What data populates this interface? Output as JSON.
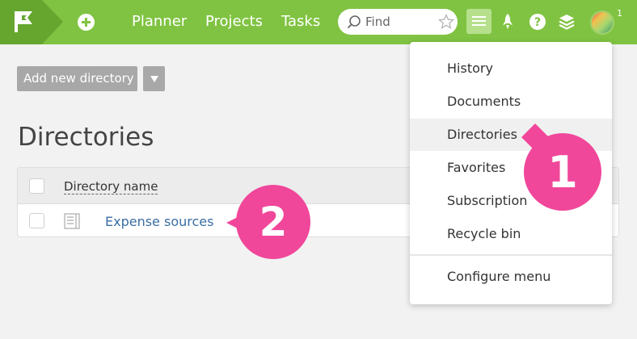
{
  "nav": {
    "links": [
      "Planner",
      "Projects",
      "Tasks"
    ],
    "search_placeholder": "Find",
    "avatar_count": "1"
  },
  "toolbar": {
    "add_label": "Add new directory"
  },
  "page": {
    "title": "Directories"
  },
  "table": {
    "column_header": "Directory name",
    "rows": [
      "Expense sources"
    ]
  },
  "dropdown": {
    "items": [
      "History",
      "Documents",
      "Directories",
      "Favorites",
      "Subscription",
      "Recycle bin"
    ],
    "configure_label": "Configure menu",
    "active_index": 2
  },
  "annotations": {
    "step1": "1",
    "step2": "2"
  },
  "colors": {
    "topbar": "#80c342",
    "accent_pink": "#f0479a",
    "link": "#3b6ea5"
  }
}
